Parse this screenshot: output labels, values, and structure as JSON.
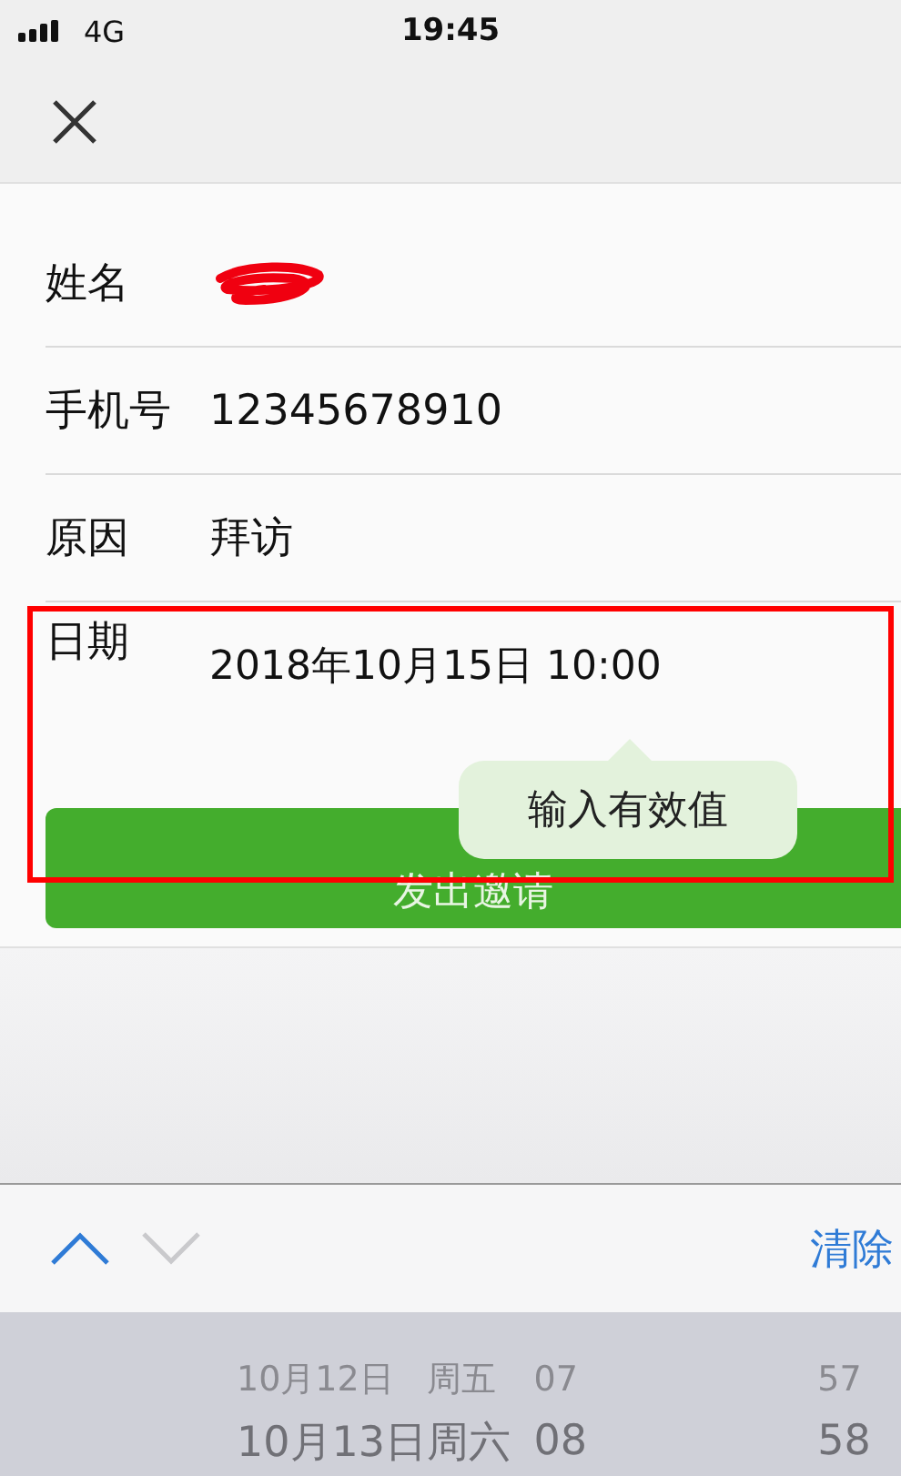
{
  "status_bar": {
    "network": "4G",
    "time": "19:45"
  },
  "form": {
    "fields": [
      {
        "label": "姓名",
        "redacted": true
      },
      {
        "label": "手机号",
        "value": "12345678910",
        "redacted": false
      },
      {
        "label": "原因",
        "value": "拜访",
        "redacted": false
      },
      {
        "label": "日期",
        "value": "2018年10月15日 10:00",
        "redacted": false
      }
    ],
    "submit_button": "发出邀请",
    "tooltip": "输入有效值"
  },
  "keyboard_toolbar": {
    "previous_disabled": false,
    "next_disabled": true,
    "clear_button": "清除"
  },
  "picker": {
    "rows": [
      {
        "date": "10月12日",
        "weekday": "周五",
        "hour": "07",
        "minute": "57"
      },
      {
        "date": "10月13日",
        "weekday": "周六",
        "hour": "08",
        "minute": "58"
      }
    ]
  },
  "annotation": {
    "kind": "highlight-box"
  }
}
